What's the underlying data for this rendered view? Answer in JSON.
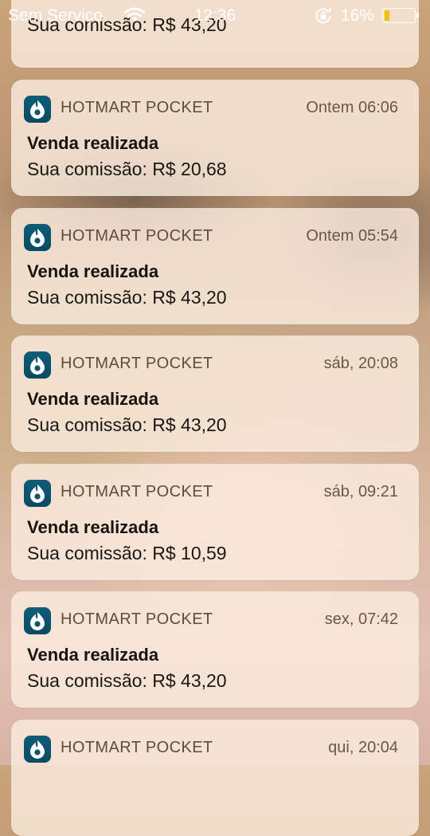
{
  "status_bar": {
    "carrier": "Sem Serviço",
    "time": "12:36",
    "battery_percent": "16%",
    "battery_level": 0.16
  },
  "partial_card": {
    "body": "Sua comissão: R$ 43,20"
  },
  "notifications": [
    {
      "app": "HOTMART POCKET",
      "time": "Ontem 06:06",
      "title": "Venda realizada",
      "body": "Sua comissão: R$ 20,68"
    },
    {
      "app": "HOTMART POCKET",
      "time": "Ontem 05:54",
      "title": "Venda realizada",
      "body": "Sua comissão: R$ 43,20"
    },
    {
      "app": "HOTMART POCKET",
      "time": "sáb, 20:08",
      "title": "Venda realizada",
      "body": "Sua comissão: R$ 43,20"
    },
    {
      "app": "HOTMART POCKET",
      "time": "sáb, 09:21",
      "title": "Venda realizada",
      "body": "Sua comissão: R$ 10,59"
    },
    {
      "app": "HOTMART POCKET",
      "time": "sex, 07:42",
      "title": "Venda realizada",
      "body": "Sua comissão: R$ 43,20"
    },
    {
      "app": "HOTMART POCKET",
      "time": "qui, 20:04"
    }
  ]
}
